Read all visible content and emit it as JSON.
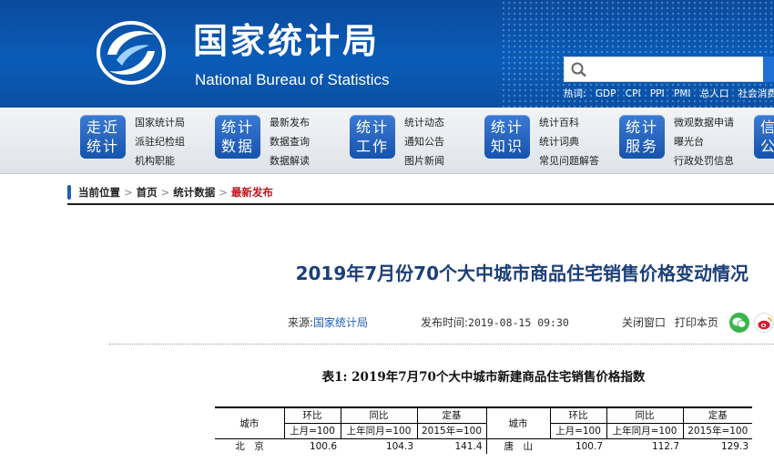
{
  "header": {
    "title_cn": "国家统计局",
    "title_en": "National Bureau of Statistics",
    "search": {
      "value": "",
      "placeholder": ""
    },
    "hot": {
      "label": "热词:",
      "items": [
        "GDP",
        "CPI",
        "PPI",
        "PMI",
        "总人口",
        "社会消费品"
      ]
    }
  },
  "nav": [
    {
      "badge": [
        "走近",
        "统计"
      ],
      "links": [
        "国家统计局",
        "派驻纪检组",
        "机构职能"
      ]
    },
    {
      "badge": [
        "统计",
        "数据"
      ],
      "links": [
        "最新发布",
        "数据查询",
        "数据解读"
      ]
    },
    {
      "badge": [
        "统计",
        "工作"
      ],
      "links": [
        "统计动态",
        "通知公告",
        "图片新闻"
      ]
    },
    {
      "badge": [
        "统计",
        "知识"
      ],
      "links": [
        "统计百科",
        "统计词典",
        "常见问题解答"
      ]
    },
    {
      "badge": [
        "统计",
        "服务"
      ],
      "links": [
        "微观数据申请",
        "曝光台",
        "行政处罚信息"
      ]
    },
    {
      "badge": [
        "信息",
        "公开"
      ],
      "links": []
    }
  ],
  "breadcrumb": {
    "items": [
      "当前位置",
      "首页",
      "统计数据"
    ],
    "current": "最新发布"
  },
  "article": {
    "title": "2019年7月份70个大中城市商品住宅销售价格变动情况",
    "source_label": "来源:",
    "source": "国家统计局",
    "date_label": "发布时间:",
    "date": "2019-08-15 09:30",
    "close_label": "关闭窗口",
    "print_label": "打印本页"
  },
  "table": {
    "caption": "表1:  2019年7月70个大中城市新建商品住宅销售价格指数",
    "city_header": "城市",
    "group_headers": [
      "环比",
      "同比",
      "定基"
    ],
    "sub_headers": [
      "上月=100",
      "上年同月=100",
      "2015年=100"
    ],
    "rows": [
      {
        "left": {
          "city": "北　京",
          "mom": "100.6",
          "yoy": "104.3",
          "base": "141.4"
        },
        "right": {
          "city": "唐　山",
          "mom": "100.7",
          "yoy": "112.7",
          "base": "129.3"
        }
      }
    ]
  }
}
